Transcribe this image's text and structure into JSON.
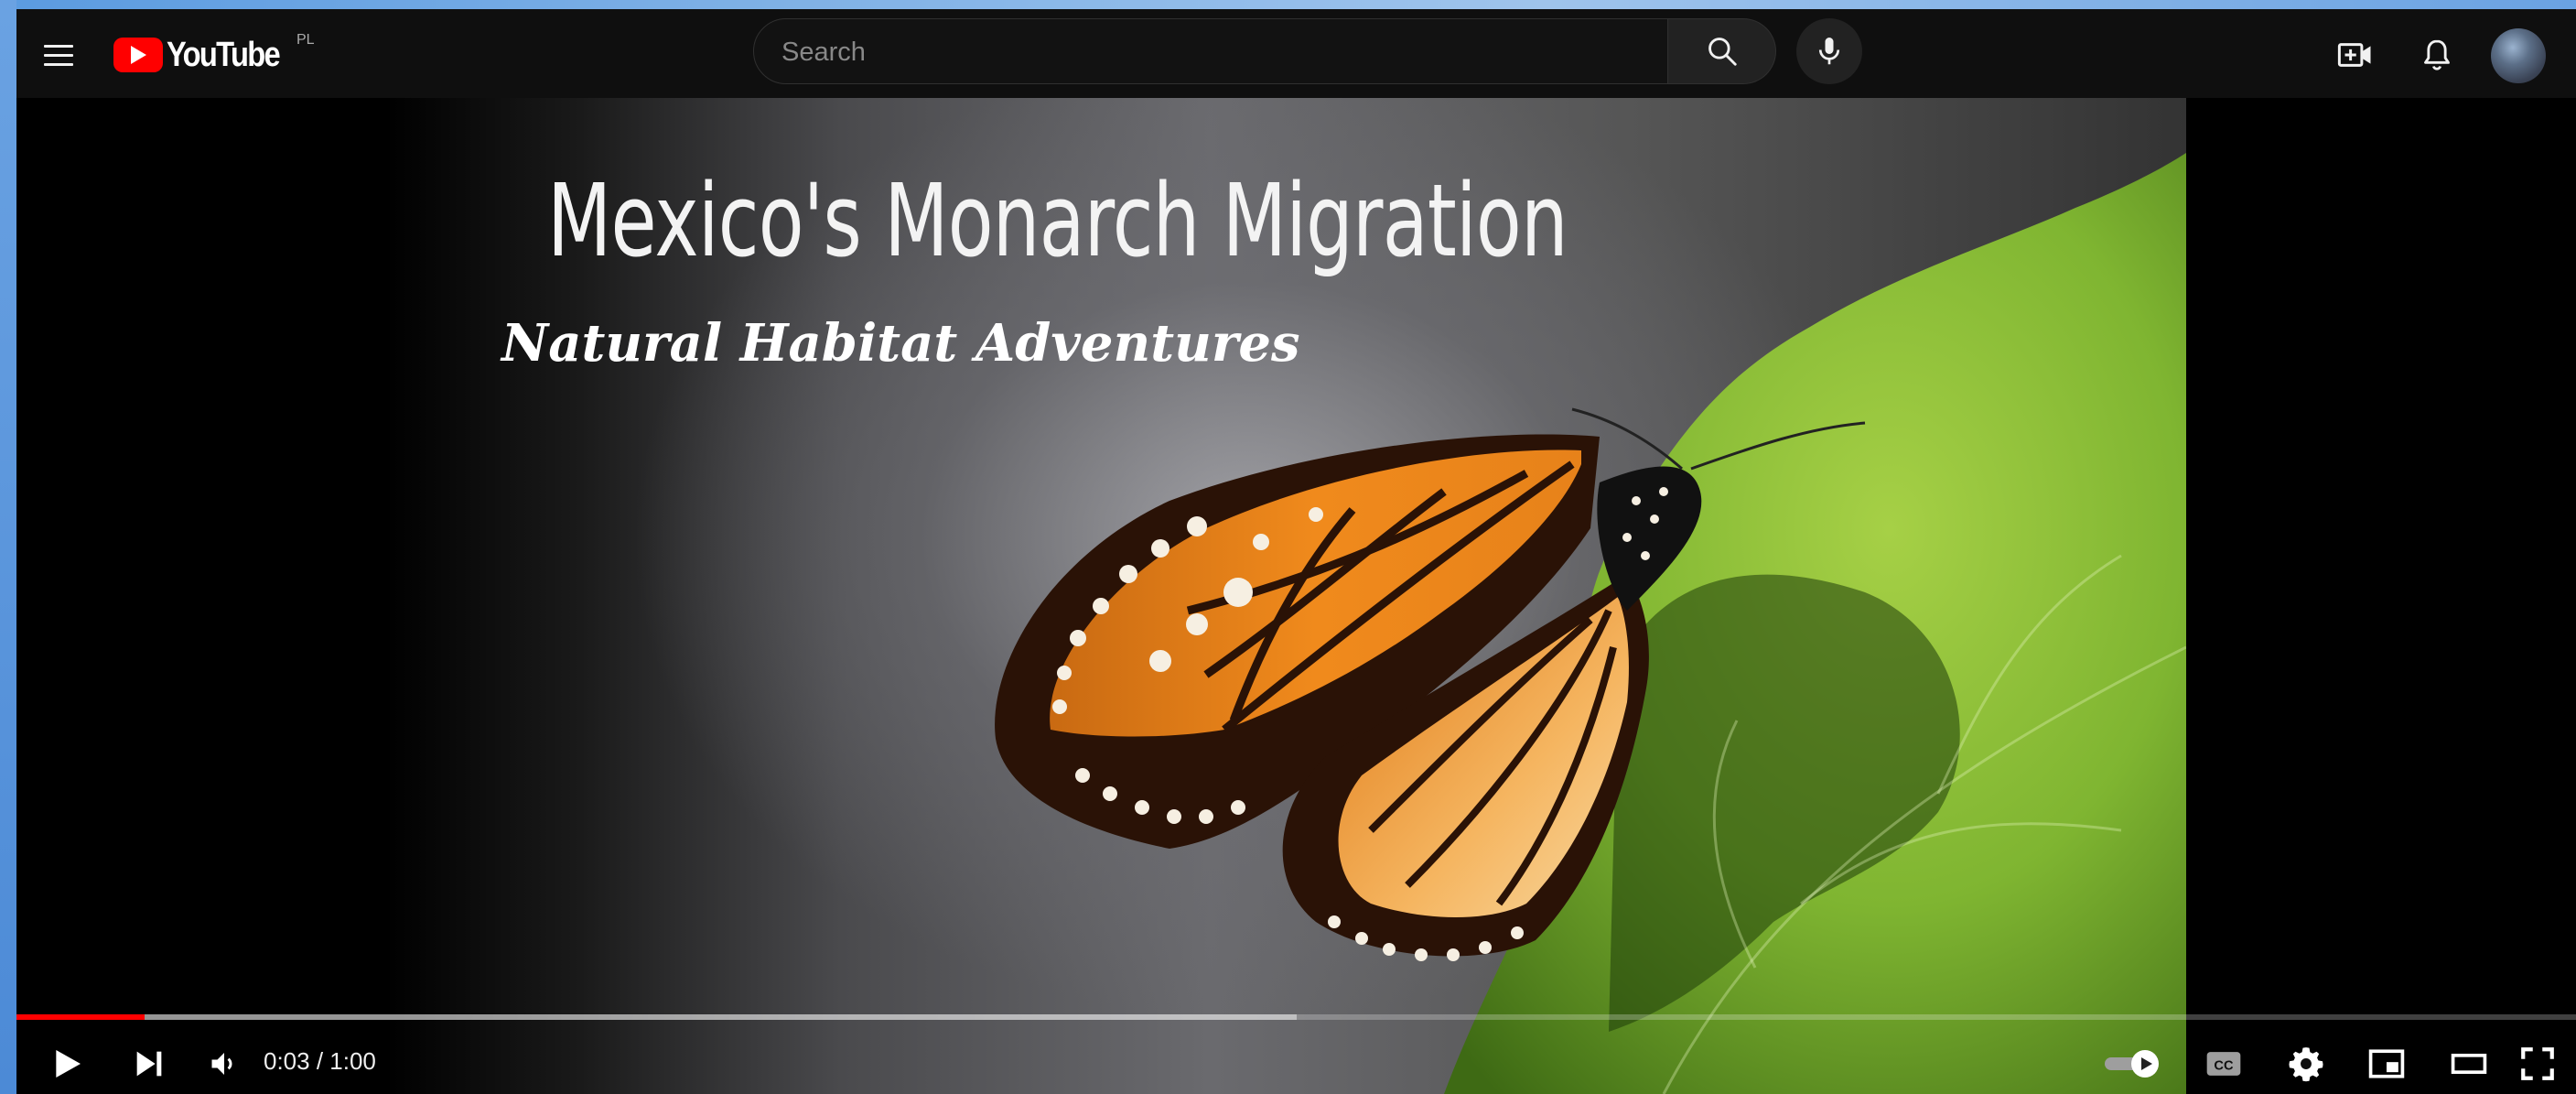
{
  "header": {
    "logo_text": "YouTube",
    "logo_country": "PL",
    "search": {
      "placeholder": "Search",
      "value": ""
    }
  },
  "player": {
    "video_title": "Mexico's Monarch Migration",
    "video_subtitle": "Natural Habitat Adventures",
    "time_display": "0:03 / 1:00",
    "progress_played_fraction": 0.05,
    "progress_loaded_fraction": 0.5,
    "autoplay": true
  },
  "icons": {
    "menu": "hamburger-icon",
    "search": "search-icon",
    "mic": "microphone-icon",
    "create": "create-video-icon",
    "notifications": "bell-icon",
    "play": "play-icon",
    "next": "next-icon",
    "volume": "volume-icon",
    "autoplay": "autoplay-toggle-icon",
    "captions": "cc-icon",
    "settings": "gear-icon",
    "miniplayer": "miniplayer-icon",
    "theater": "theater-mode-icon",
    "fullscreen": "fullscreen-icon"
  },
  "colors": {
    "brand": "#ff0000",
    "background": "#0f0f0f",
    "progress": "#ff0000"
  }
}
